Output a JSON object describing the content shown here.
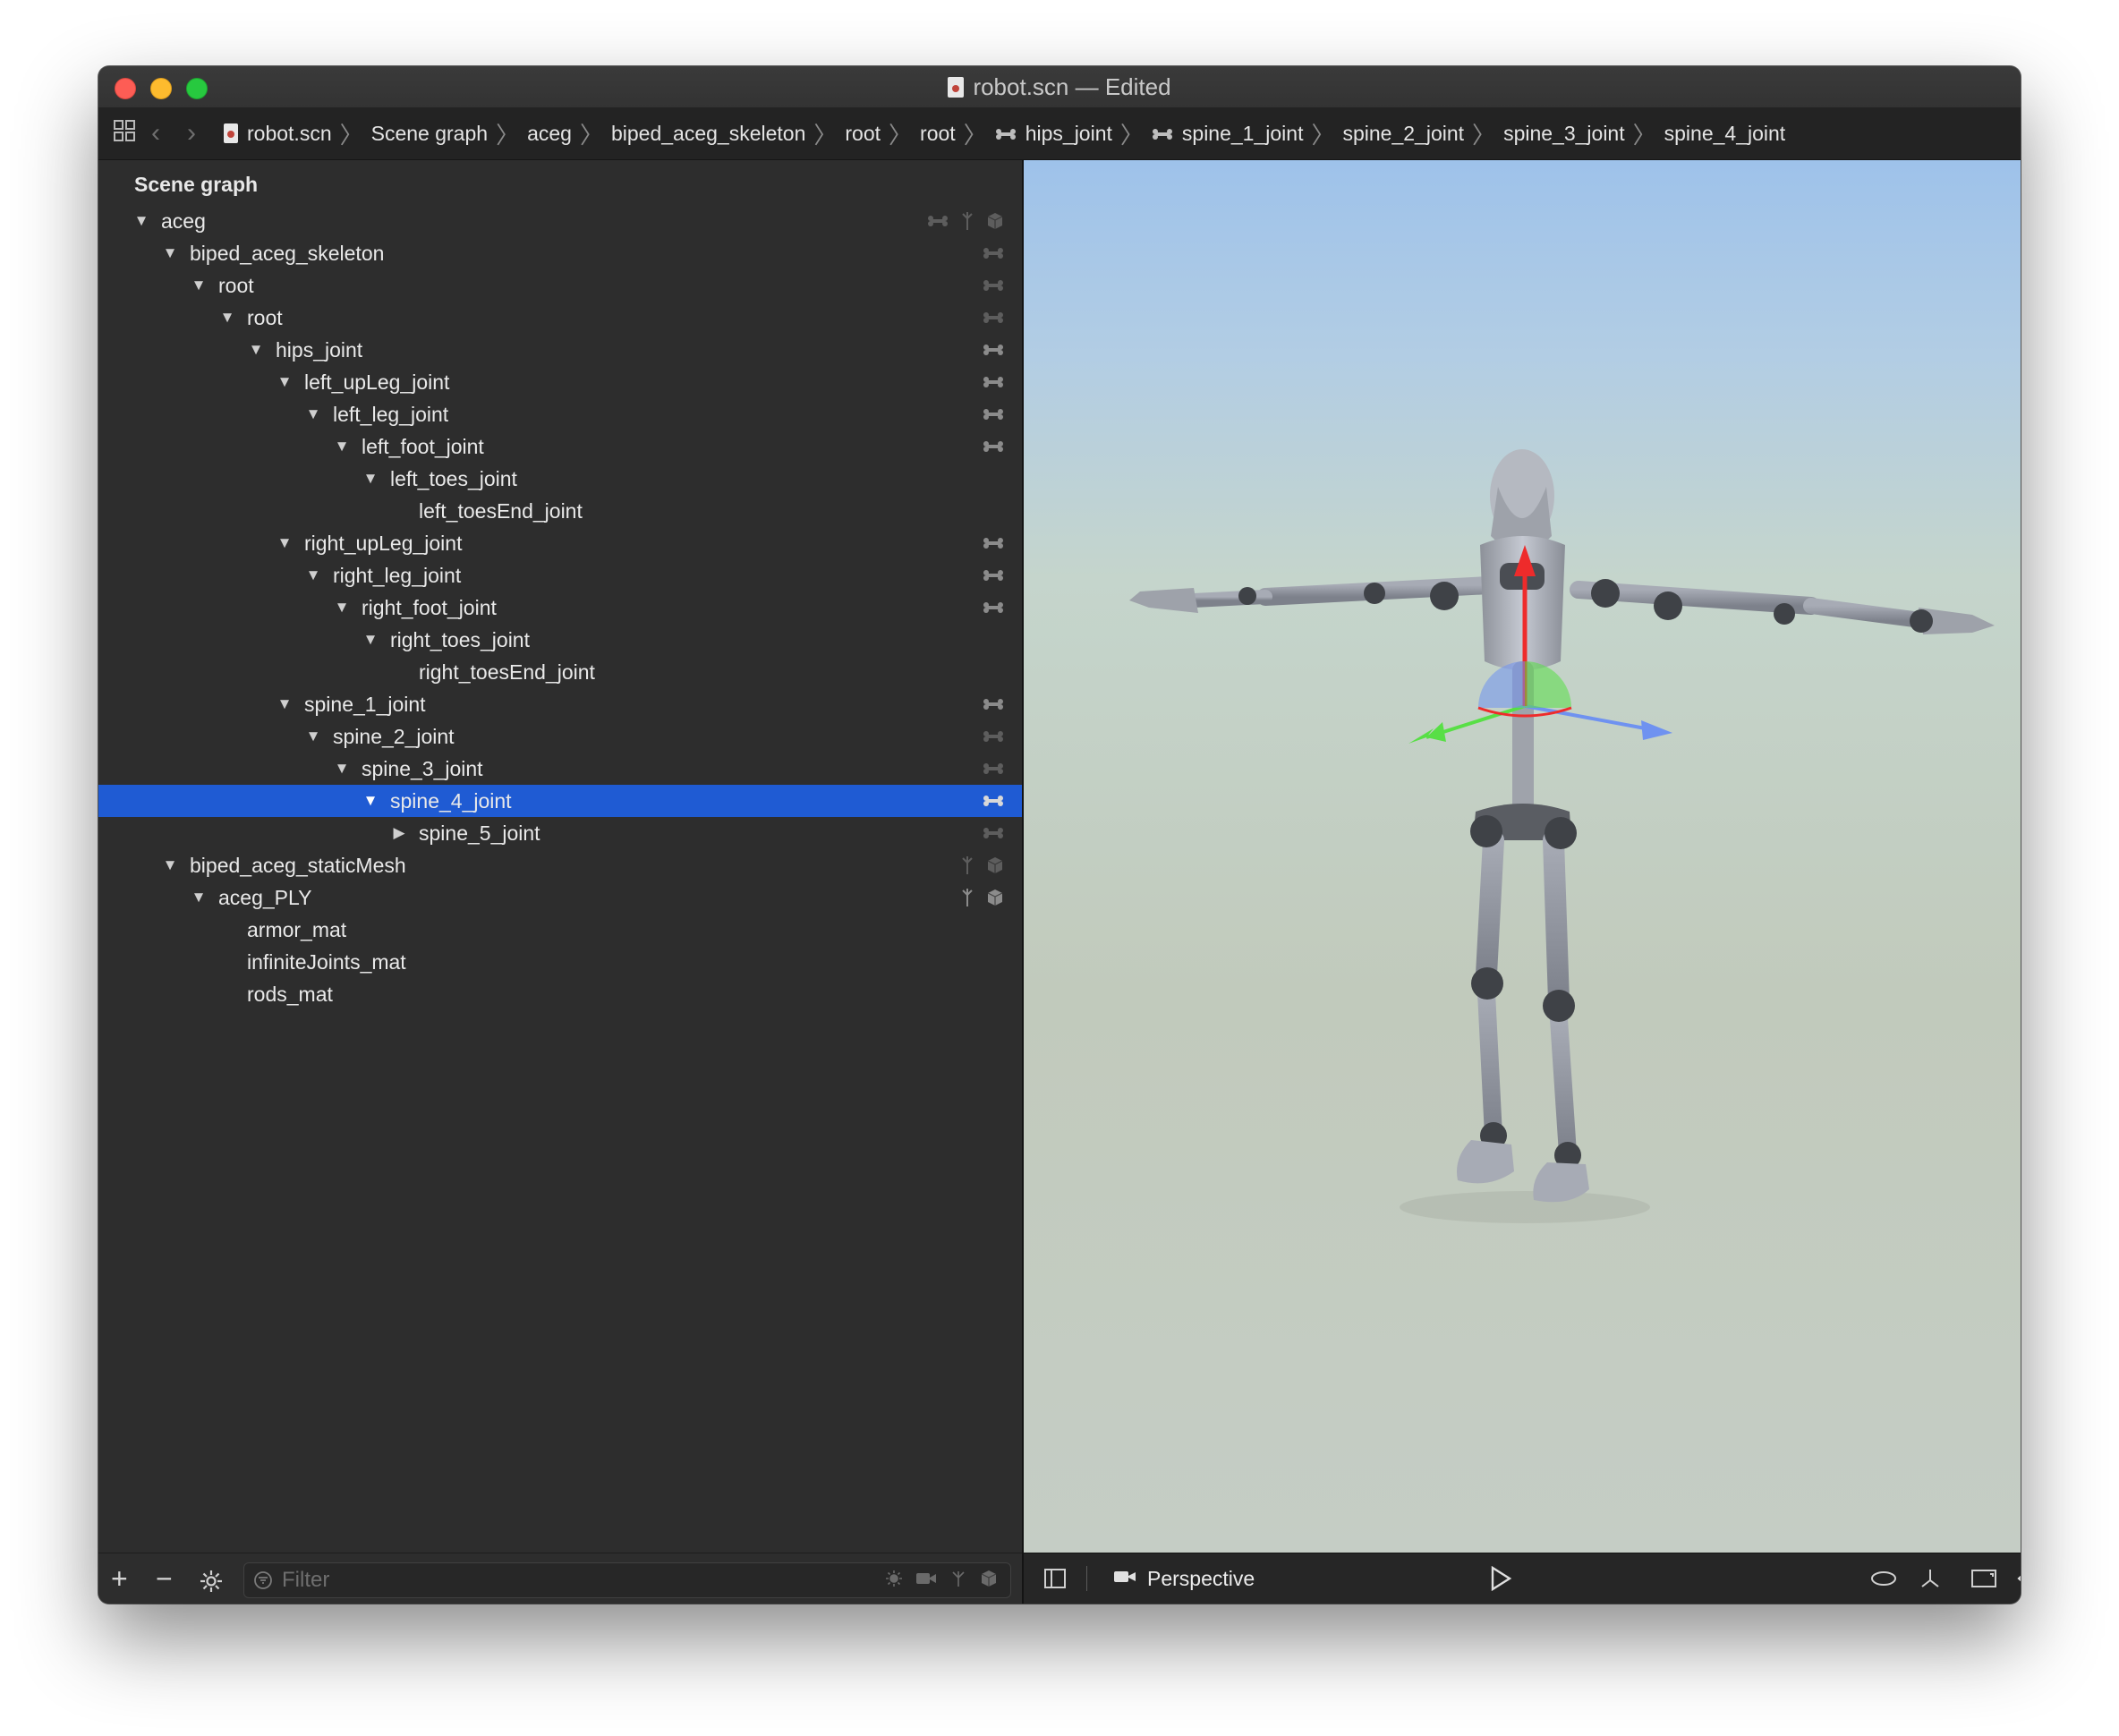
{
  "window": {
    "title": "robot.scn — Edited"
  },
  "pathbar": {
    "crumbs": [
      {
        "label": "robot.scn",
        "icon": "scene-file-icon"
      },
      {
        "label": "Scene graph"
      },
      {
        "label": "aceg"
      },
      {
        "label": "biped_aceg_skeleton"
      },
      {
        "label": "root"
      },
      {
        "label": "root"
      },
      {
        "label": "hips_joint",
        "icon": "bone-icon"
      },
      {
        "label": "spine_1_joint",
        "icon": "bone-icon"
      },
      {
        "label": "spine_2_joint"
      },
      {
        "label": "spine_3_joint"
      },
      {
        "label": "spine_4_joint"
      }
    ]
  },
  "sidebar": {
    "heading": "Scene graph",
    "nodes": [
      {
        "label": "aceg",
        "depth": 0,
        "expander": "expanded",
        "icons": [
          "bone-icon",
          "morpher-icon",
          "cube-icon"
        ]
      },
      {
        "label": "biped_aceg_skeleton",
        "depth": 1,
        "expander": "expanded",
        "icons": [
          "bone-icon"
        ]
      },
      {
        "label": "root",
        "depth": 2,
        "expander": "expanded",
        "icons": [
          "bone-icon"
        ]
      },
      {
        "label": "root",
        "depth": 3,
        "expander": "expanded",
        "icons": [
          "bone-icon"
        ]
      },
      {
        "label": "hips_joint",
        "depth": 4,
        "expander": "expanded",
        "icons": [
          "bone-icon"
        ],
        "emphasis": true
      },
      {
        "label": "left_upLeg_joint",
        "depth": 5,
        "expander": "expanded",
        "icons": [
          "bone-icon"
        ],
        "emphasis": true
      },
      {
        "label": "left_leg_joint",
        "depth": 6,
        "expander": "expanded",
        "icons": [
          "bone-icon"
        ],
        "emphasis": true
      },
      {
        "label": "left_foot_joint",
        "depth": 7,
        "expander": "expanded",
        "icons": [
          "bone-icon"
        ],
        "emphasis": true
      },
      {
        "label": "left_toes_joint",
        "depth": 8,
        "expander": "expanded",
        "icons": []
      },
      {
        "label": "left_toesEnd_joint",
        "depth": 9,
        "expander": "none",
        "icons": []
      },
      {
        "label": "right_upLeg_joint",
        "depth": 5,
        "expander": "expanded",
        "icons": [
          "bone-icon"
        ],
        "emphasis": true
      },
      {
        "label": "right_leg_joint",
        "depth": 6,
        "expander": "expanded",
        "icons": [
          "bone-icon"
        ],
        "emphasis": true
      },
      {
        "label": "right_foot_joint",
        "depth": 7,
        "expander": "expanded",
        "icons": [
          "bone-icon"
        ],
        "emphasis": true
      },
      {
        "label": "right_toes_joint",
        "depth": 8,
        "expander": "expanded",
        "icons": []
      },
      {
        "label": "right_toesEnd_joint",
        "depth": 9,
        "expander": "none",
        "icons": []
      },
      {
        "label": "spine_1_joint",
        "depth": 5,
        "expander": "expanded",
        "icons": [
          "bone-icon"
        ],
        "emphasis": true
      },
      {
        "label": "spine_2_joint",
        "depth": 6,
        "expander": "expanded",
        "icons": [
          "bone-icon"
        ]
      },
      {
        "label": "spine_3_joint",
        "depth": 7,
        "expander": "expanded",
        "icons": [
          "bone-icon"
        ]
      },
      {
        "label": "spine_4_joint",
        "depth": 8,
        "expander": "expanded",
        "icons": [
          "bone-icon"
        ],
        "selected": true
      },
      {
        "label": "spine_5_joint",
        "depth": 9,
        "expander": "collapsed",
        "icons": [
          "bone-icon"
        ]
      },
      {
        "label": "biped_aceg_staticMesh",
        "depth": 1,
        "expander": "expanded",
        "icons": [
          "morpher-icon",
          "cube-icon"
        ]
      },
      {
        "label": "aceg_PLY",
        "depth": 2,
        "expander": "expanded",
        "icons": [
          "morpher-icon",
          "cube-icon"
        ],
        "emphasis": true
      },
      {
        "label": "armor_mat",
        "depth": 3,
        "expander": "none",
        "icons": []
      },
      {
        "label": "infiniteJoints_mat",
        "depth": 3,
        "expander": "none",
        "icons": []
      },
      {
        "label": "rods_mat",
        "depth": 3,
        "expander": "none",
        "icons": []
      }
    ]
  },
  "filter": {
    "placeholder": "Filter",
    "value": ""
  },
  "viewport": {
    "camera_label": "Perspective"
  },
  "colors": {
    "selection": "#1f5bd3",
    "axis_x": "#6f92f0",
    "axis_y": "#ee2b2b",
    "axis_z": "#57e04a"
  }
}
